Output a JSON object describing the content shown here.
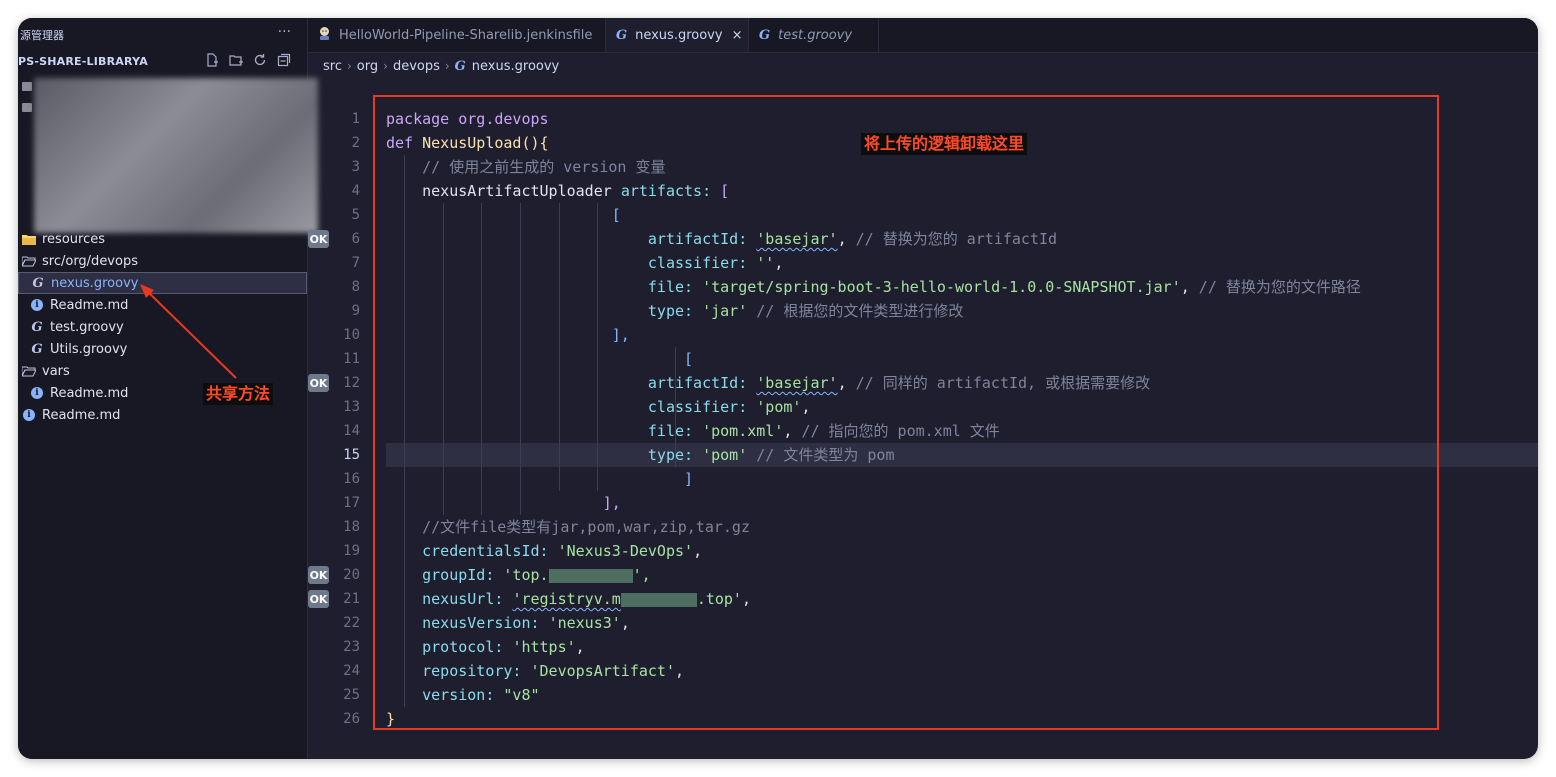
{
  "sidebar": {
    "title": "源管理器",
    "more": "···",
    "folder": "PS-SHARE-LIBRARYA",
    "items": [
      {
        "label": "resources"
      },
      {
        "label": "src/org/devops"
      },
      {
        "label": "nexus.groovy"
      },
      {
        "label": "Readme.md"
      },
      {
        "label": "test.groovy"
      },
      {
        "label": "Utils.groovy"
      },
      {
        "label": "vars"
      },
      {
        "label": "Readme.md"
      },
      {
        "label": "Readme.md"
      }
    ]
  },
  "tabs": [
    {
      "label": "HelloWorld-Pipeline-Sharelib.jenkinsfile"
    },
    {
      "label": "nexus.groovy",
      "close": "×"
    },
    {
      "label": "test.groovy"
    }
  ],
  "breadcrumb": [
    "src",
    "org",
    "devops",
    "nexus.groovy"
  ],
  "editor": {
    "current_line": 15,
    "ok_label": "OK",
    "lines": [
      {
        "n": "1"
      },
      {
        "n": "2"
      },
      {
        "n": "3"
      },
      {
        "n": "4"
      },
      {
        "n": "5"
      },
      {
        "n": "6"
      },
      {
        "n": "7"
      },
      {
        "n": "8"
      },
      {
        "n": "9"
      },
      {
        "n": "10"
      },
      {
        "n": "11"
      },
      {
        "n": "12"
      },
      {
        "n": "13"
      },
      {
        "n": "14"
      },
      {
        "n": "15"
      },
      {
        "n": "16"
      },
      {
        "n": "17"
      },
      {
        "n": "18"
      },
      {
        "n": "19"
      },
      {
        "n": "20"
      },
      {
        "n": "21"
      },
      {
        "n": "22"
      },
      {
        "n": "23"
      },
      {
        "n": "24"
      },
      {
        "n": "25"
      },
      {
        "n": "26"
      }
    ],
    "code": {
      "pkg_kw": "package",
      "pkg_name": "org.devops",
      "def_kw": "def",
      "fn_name": "NexusUpload",
      "fn_open": "(){",
      "c_version": "// 使用之前生成的 version 变量",
      "uploader": "nexusArtifactUploader",
      "artifacts_key": "artifacts:",
      "open_sq": "[",
      "artifactId_key": "artifactId:",
      "artifactId_val": "'basejar'",
      "c_artifact1": "// 替换为您的 artifactId",
      "classifier_key": "classifier:",
      "classifier_val1": "''",
      "file_key": "file:",
      "file_val1": "'target/spring-boot-3-hello-world-1.0.0-SNAPSHOT.jar'",
      "c_file1": "// 替换为您的文件路径",
      "type_key": "type:",
      "type_val1": "'jar'",
      "c_type1": "// 根据您的文件类型进行修改",
      "close_sq_comma": "],",
      "c_artifact2": "// 同样的 artifactId, 或根据需要修改",
      "classifier_val2": "'pom'",
      "file_val2": "'pom.xml'",
      "c_file2": "// 指向您的 pom.xml 文件",
      "type_val2": "'pom'",
      "c_type2": "// 文件类型为 pom",
      "close_sq": "]",
      "c_types": "//文件file类型有jar,pom,war,zip,tar.gz",
      "cred_key": "credentialsId:",
      "cred_val": "'Nexus3-DevOps'",
      "group_key": "groupId:",
      "group_val_start": "'top.",
      "group_val_end": "',",
      "nexusurl_key": "nexusUrl:",
      "nexusurl_val_start": "'registryv.m",
      "nexusurl_val_end": ".top'",
      "nexusver_key": "nexusVersion:",
      "nexusver_val": "'nexus3'",
      "protocol_key": "protocol:",
      "protocol_val": "'https'",
      "repo_key": "repository:",
      "repo_val": "'DevopsArtifact'",
      "version_key": "version:",
      "version_val": "\"v8\"",
      "comma": ",",
      "close_brace": "}"
    }
  },
  "annotations": {
    "box_note": "将上传的逻辑卸载这里",
    "arrow_note": "共享方法",
    "color": "#e8381f"
  }
}
